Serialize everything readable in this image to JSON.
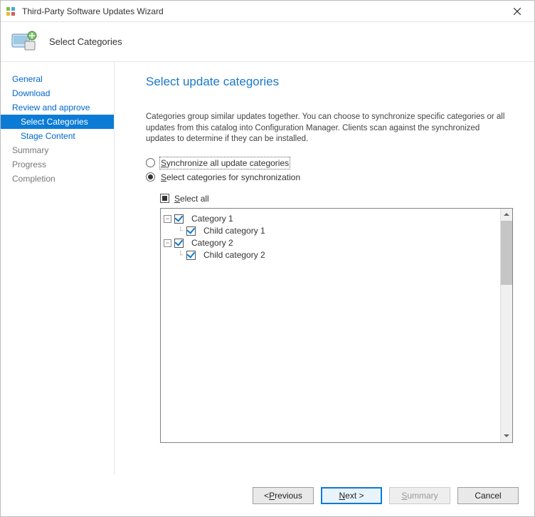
{
  "window": {
    "title": "Third-Party Software Updates Wizard"
  },
  "header": {
    "subtitle": "Select Categories"
  },
  "sidebar": {
    "items": [
      {
        "label": "General",
        "selected": false,
        "child": false
      },
      {
        "label": "Download",
        "selected": false,
        "child": false
      },
      {
        "label": "Review and approve",
        "selected": false,
        "child": false
      },
      {
        "label": "Select Categories",
        "selected": true,
        "child": true
      },
      {
        "label": "Stage Content",
        "selected": false,
        "child": true
      },
      {
        "label": "Summary",
        "selected": false,
        "child": false,
        "muted": true
      },
      {
        "label": "Progress",
        "selected": false,
        "child": false,
        "muted": true
      },
      {
        "label": "Completion",
        "selected": false,
        "child": false,
        "muted": true
      }
    ]
  },
  "page": {
    "title": "Select update categories",
    "description": "Categories group similar updates together. You can choose to synchronize specific categories or all updates from this catalog into Configuration Manager. Clients scan against the synchronized updates to determine if they can be installed.",
    "radio_all_prefix": "S",
    "radio_all_rest": "ynchronize all update categories",
    "radio_sel_prefix": "S",
    "radio_sel_rest": "elect categories for synchronization",
    "selectall_prefix": "S",
    "selectall_rest": "elect all",
    "tree": [
      {
        "label": "Category 1",
        "level": 0
      },
      {
        "label": "Child category 1",
        "level": 1
      },
      {
        "label": "Category 2",
        "level": 0
      },
      {
        "label": "Child category 2",
        "level": 1
      }
    ]
  },
  "footer": {
    "previous_pre": "< ",
    "previous_ul": "P",
    "previous_rest": "revious",
    "next_ul": "N",
    "next_rest": "ext >",
    "summary_ul": "S",
    "summary_rest": "ummary",
    "cancel": "Cancel"
  }
}
